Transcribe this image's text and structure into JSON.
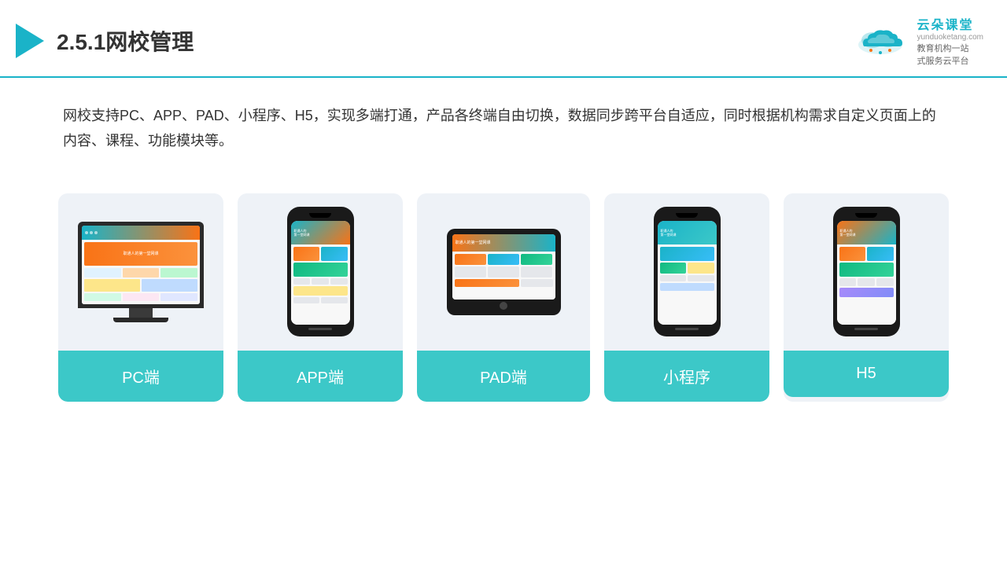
{
  "header": {
    "title": "2.5.1网校管理",
    "logo_name": "云朵课堂",
    "logo_url": "yunduoketang.com",
    "logo_slogan_line1": "教育机构一站",
    "logo_slogan_line2": "式服务云平台"
  },
  "description": {
    "text": "网校支持PC、APP、PAD、小程序、H5，实现多端打通，产品各终端自由切换，数据同步跨平台自适应，同时根据机构需求自定义页面上的内容、课程、功能模块等。"
  },
  "cards": [
    {
      "id": "pc",
      "label": "PC端",
      "device": "pc"
    },
    {
      "id": "app",
      "label": "APP端",
      "device": "phone"
    },
    {
      "id": "pad",
      "label": "PAD端",
      "device": "pad"
    },
    {
      "id": "miniapp",
      "label": "小程序",
      "device": "phone2"
    },
    {
      "id": "h5",
      "label": "H5",
      "device": "phone3"
    }
  ],
  "colors": {
    "accent": "#1ab3c8",
    "card_bg": "#eef2f7",
    "label_bg": "#3cc8c8"
  }
}
